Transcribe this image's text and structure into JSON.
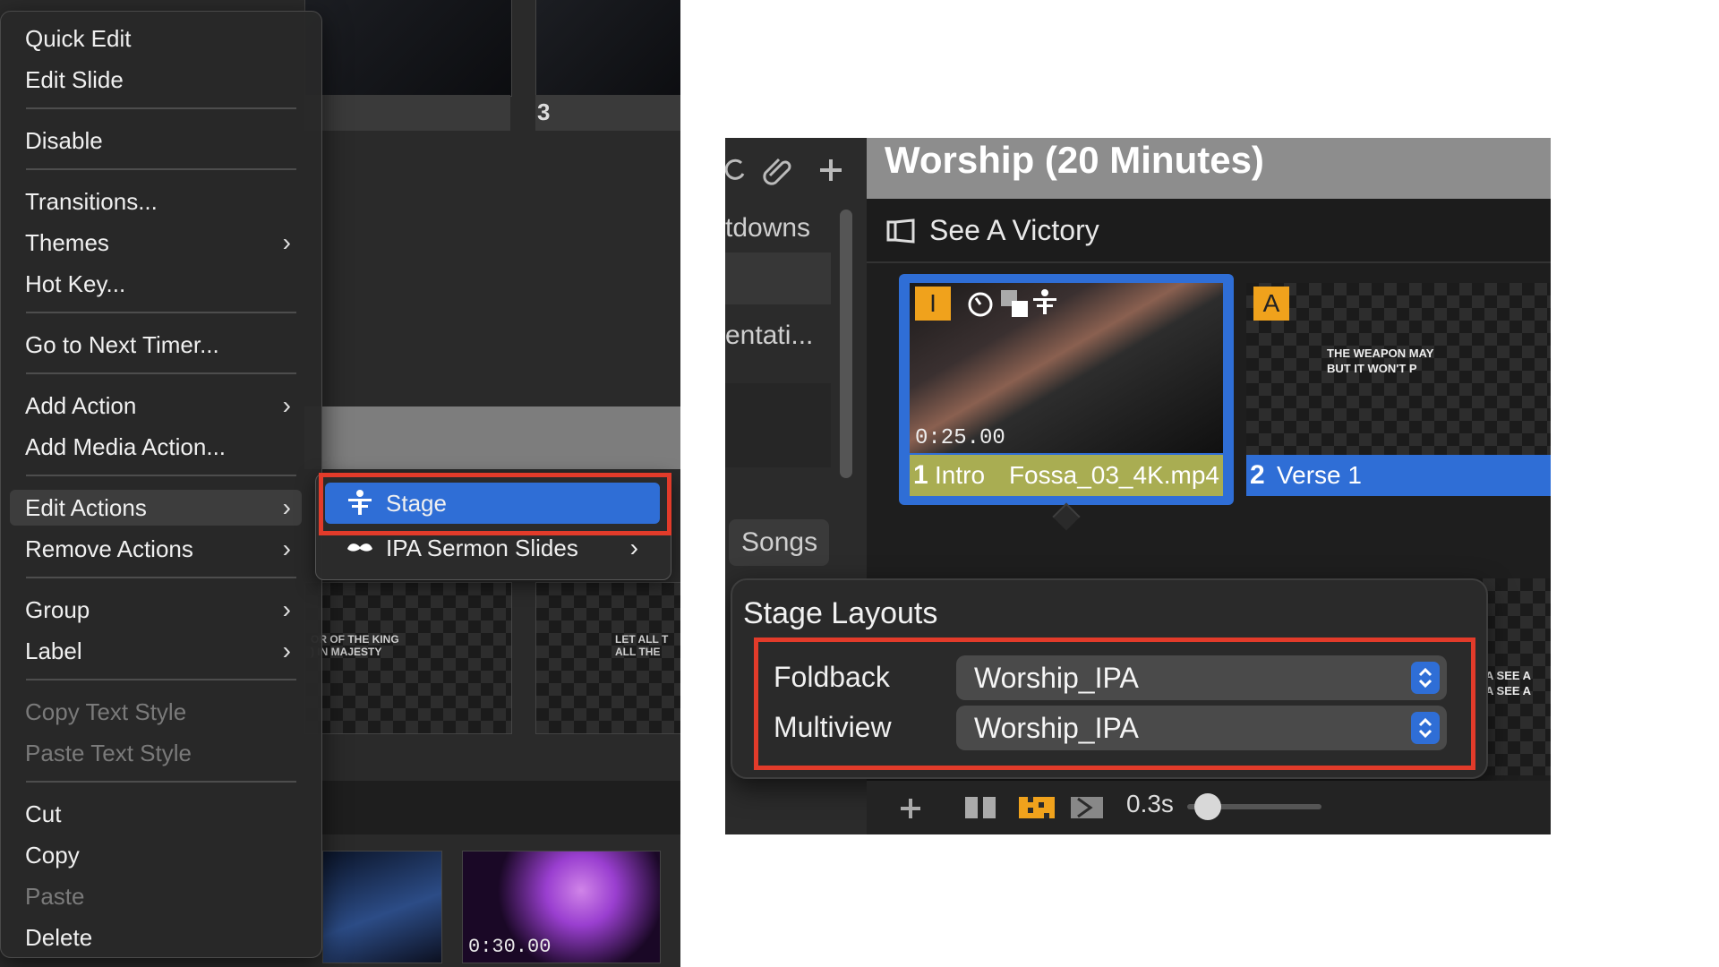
{
  "left": {
    "thumbs": {
      "slide3_number": "3",
      "lyric_left": "OR OF THE KING\n) IN MAJESTY",
      "lyric_right": "LET ALL T\nALL THE",
      "media_timecode": "0:30.00"
    },
    "context_menu": {
      "items": [
        {
          "label": "Quick Edit",
          "chevron": false,
          "disabled": false
        },
        {
          "label": "Edit Slide",
          "chevron": false,
          "disabled": false
        },
        {
          "label": "Disable",
          "chevron": false,
          "disabled": false
        },
        {
          "label": "Transitions...",
          "chevron": false,
          "disabled": false
        },
        {
          "label": "Themes",
          "chevron": true,
          "disabled": false
        },
        {
          "label": "Hot Key...",
          "chevron": false,
          "disabled": false
        },
        {
          "label": "Go to Next Timer...",
          "chevron": false,
          "disabled": false
        },
        {
          "label": "Add Action",
          "chevron": true,
          "disabled": false
        },
        {
          "label": "Add Media Action...",
          "chevron": false,
          "disabled": false
        },
        {
          "label": "Edit Actions",
          "chevron": true,
          "disabled": false,
          "highlighted": true
        },
        {
          "label": "Remove Actions",
          "chevron": true,
          "disabled": false
        },
        {
          "label": "Group",
          "chevron": true,
          "disabled": false
        },
        {
          "label": "Label",
          "chevron": true,
          "disabled": false
        },
        {
          "label": "Copy Text Style",
          "chevron": false,
          "disabled": true
        },
        {
          "label": "Paste Text Style",
          "chevron": false,
          "disabled": true
        },
        {
          "label": "Cut",
          "chevron": false,
          "disabled": false
        },
        {
          "label": "Copy",
          "chevron": false,
          "disabled": false
        },
        {
          "label": "Paste",
          "chevron": false,
          "disabled": true
        },
        {
          "label": "Delete",
          "chevron": false,
          "disabled": false
        }
      ],
      "chevron_glyph": "›"
    },
    "submenu": {
      "items": [
        {
          "label": "Stage",
          "icon": "stage-icon",
          "selected": true
        },
        {
          "label": "IPA Sermon Slides",
          "icon": "mustache-icon",
          "chevron": "›"
        }
      ]
    }
  },
  "right": {
    "library": {
      "rows": [
        "tdowns",
        "entati...",
        "Songs"
      ]
    },
    "document_title": "Worship (20 Minutes)",
    "song_title": "See A Victory",
    "slides": [
      {
        "badge": "I",
        "timecode": "0:25.00",
        "number": "1",
        "group": "Intro",
        "media": "Fossa_03_4K.mp4",
        "label_color": "#a9ad52",
        "selected": true
      },
      {
        "badge": "A",
        "lyric": "THE WEAPON MAY\nBUT IT WON'T P",
        "number": "2",
        "group": "Verse 1",
        "label_color": "#2f6ed6"
      }
    ],
    "partial_lyric": "INA SEE A\nINA SEE A",
    "stage_layouts": {
      "title": "Stage Layouts",
      "rows": [
        {
          "label": "Foldback",
          "value": "Worship_IPA"
        },
        {
          "label": "Multiview",
          "value": "Worship_IPA"
        }
      ]
    },
    "bottom_bar": {
      "transition_time": "0.3s"
    }
  },
  "colors": {
    "accent_blue": "#2f6ed6",
    "highlight_red": "#e23b2a",
    "badge_orange": "#f0a21c"
  }
}
